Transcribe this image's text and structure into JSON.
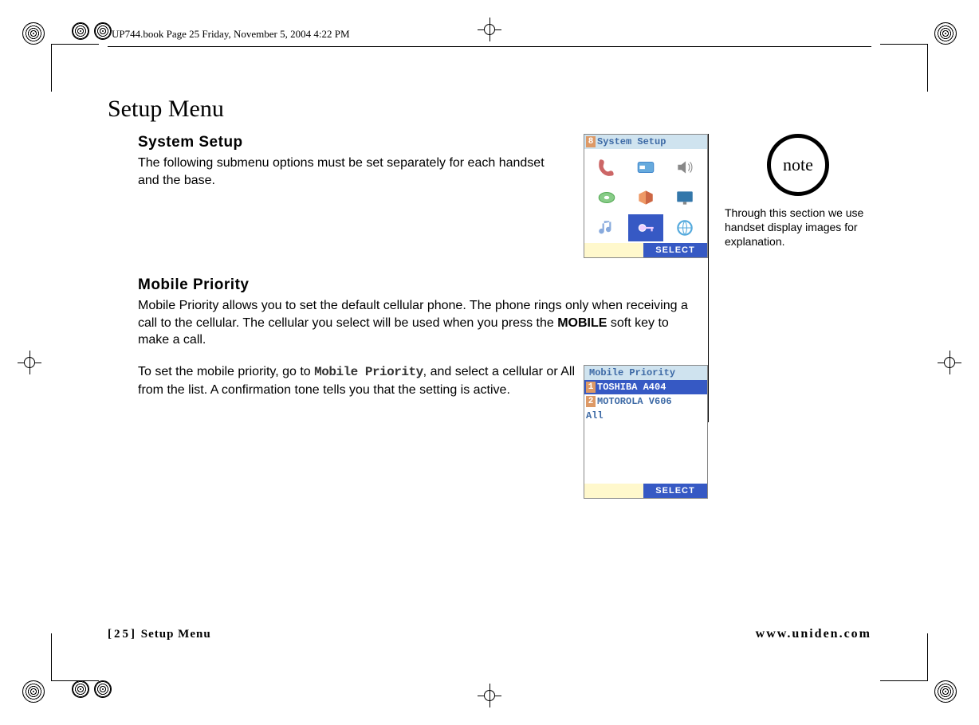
{
  "runner": "UP744.book  Page 25  Friday, November 5, 2004  4:22 PM",
  "page_title": "Setup Menu",
  "sections": {
    "system_setup": {
      "heading": "System Setup",
      "body": "The following submenu options must be set separately for each handset and the base."
    },
    "mobile_priority": {
      "heading": "Mobile Priority",
      "body1_a": "Mobile Priority allows you to set the default cellular phone. The phone rings only when receiving a call to the cellular. The cellular you select will be used when you press the ",
      "body1_bold": "MOBILE",
      "body1_b": " soft key to make a call.",
      "body2_a": "To set the mobile priority, go to ",
      "body2_mono": "Mobile Priority",
      "body2_b": ", and select a cellular or All from the list. A confirmation tone tells you that the setting is active."
    }
  },
  "note": {
    "label": "note",
    "text": "Through this section we use handset display images for explanation."
  },
  "lcd1": {
    "title_num": "8",
    "title": "System Setup",
    "softkey": "SELECT",
    "icons": [
      "handset-icon",
      "card-icon",
      "volume-icon",
      "disc-icon",
      "box-icon",
      "screen-icon",
      "music-icon",
      "key-icon",
      "globe-icon"
    ],
    "selected_index": 7
  },
  "lcd2": {
    "title": "Mobile Priority",
    "rows": [
      {
        "num": "1",
        "label": "TOSHIBA A404",
        "selected": true
      },
      {
        "num": "2",
        "label": "MOTOROLA V606",
        "selected": false
      }
    ],
    "all_label": "All",
    "softkey": "SELECT"
  },
  "footer": {
    "page_code": "[25]",
    "page_label": "Setup Menu",
    "url": "www.uniden.com"
  }
}
